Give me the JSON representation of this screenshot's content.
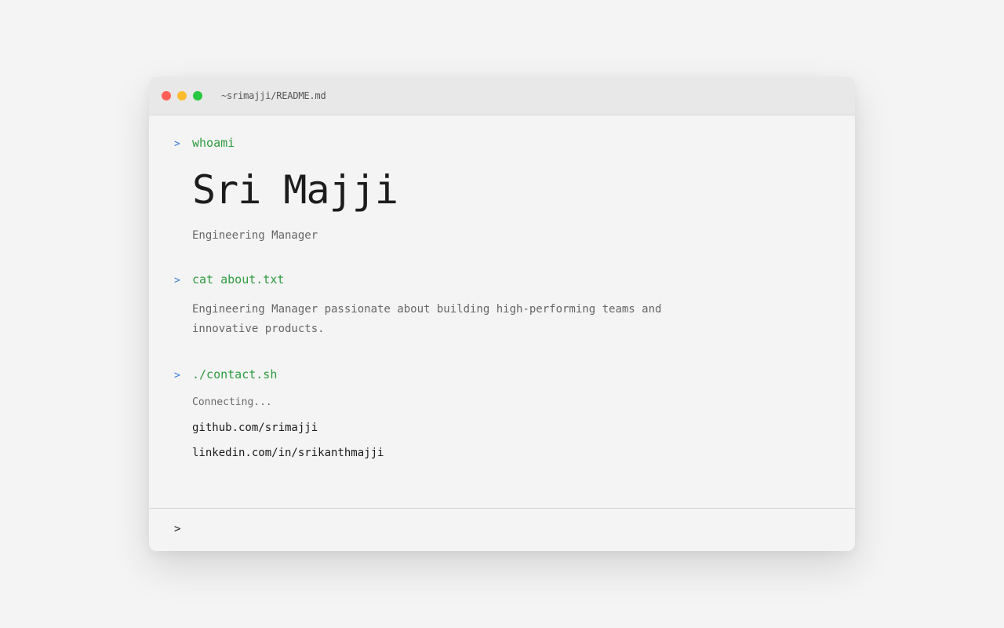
{
  "window": {
    "title": "~srimajji/README.md",
    "controls": {
      "close_color": "#ff5f57",
      "minimize_color": "#febc2e",
      "maximize_color": "#28c840"
    }
  },
  "terminal": {
    "prompt_symbol": ">",
    "sections": {
      "whoami": {
        "command": "whoami",
        "name": "Sri Majji",
        "role": "Engineering Manager"
      },
      "about": {
        "command": "cat about.txt",
        "text": "Engineering Manager passionate about building high-performing teams and innovative products."
      },
      "contact": {
        "command": "./contact.sh",
        "status": "Connecting...",
        "github": "github.com/srimajji",
        "linkedin": "linkedin.com/in/srikanthmajji"
      }
    },
    "input_prompt": ">"
  },
  "colors": {
    "prompt": "#3b7fd6",
    "command": "#2e9b3f"
  }
}
